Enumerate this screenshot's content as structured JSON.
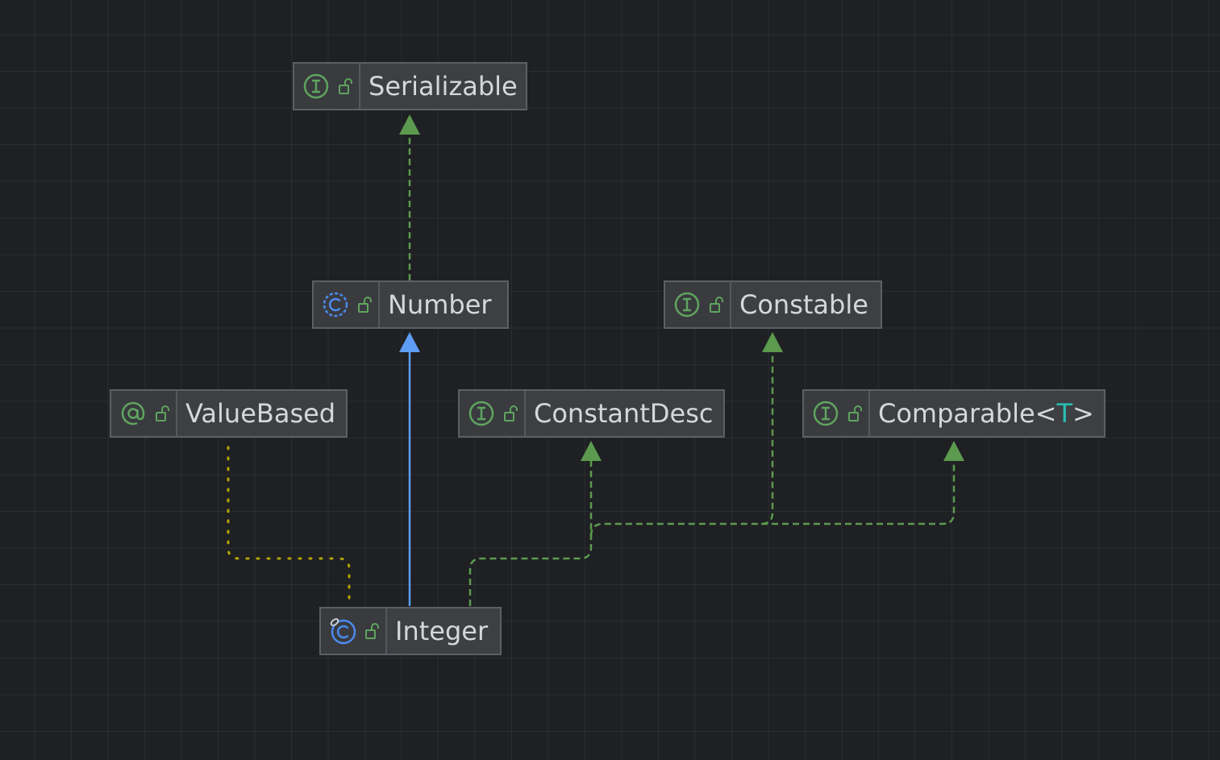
{
  "colors": {
    "interface": "#5fa45e",
    "class": "#4d8af0",
    "extends_edge": "#5d9df5",
    "implements_edge": "#5c9a4f",
    "annotation_edge": "#b3a600"
  },
  "nodes": [
    {
      "id": "serializable",
      "label": "Serializable",
      "kind": "interface",
      "kind_icon": "interface-icon",
      "visibility_icon": "unlock-icon"
    },
    {
      "id": "number",
      "label": "Number",
      "kind": "abstract-class",
      "kind_icon": "abstract-class-icon",
      "visibility_icon": "unlock-icon"
    },
    {
      "id": "constable",
      "label": "Constable",
      "kind": "interface",
      "kind_icon": "interface-icon",
      "visibility_icon": "unlock-icon"
    },
    {
      "id": "valuebased",
      "label": "ValueBased",
      "kind": "annotation",
      "kind_icon": "annotation-icon",
      "visibility_icon": "unlock-icon"
    },
    {
      "id": "constantdesc",
      "label": "ConstantDesc",
      "kind": "interface",
      "kind_icon": "interface-icon",
      "visibility_icon": "unlock-icon"
    },
    {
      "id": "comparable",
      "label": "Comparable<",
      "type_param": "T",
      "label_suffix": ">",
      "kind": "interface",
      "kind_icon": "interface-icon",
      "visibility_icon": "unlock-icon"
    },
    {
      "id": "integer",
      "label": "Integer",
      "kind": "final-class",
      "kind_icon": "final-class-icon",
      "visibility_icon": "unlock-icon"
    }
  ],
  "edges": [
    {
      "from": "number",
      "to": "serializable",
      "relation": "implements"
    },
    {
      "from": "integer",
      "to": "number",
      "relation": "extends"
    },
    {
      "from": "integer",
      "to": "constantdesc",
      "relation": "implements"
    },
    {
      "from": "integer",
      "to": "constable",
      "relation": "implements"
    },
    {
      "from": "integer",
      "to": "comparable",
      "relation": "implements"
    },
    {
      "from": "integer",
      "to": "valuebased",
      "relation": "annotated-by"
    }
  ]
}
